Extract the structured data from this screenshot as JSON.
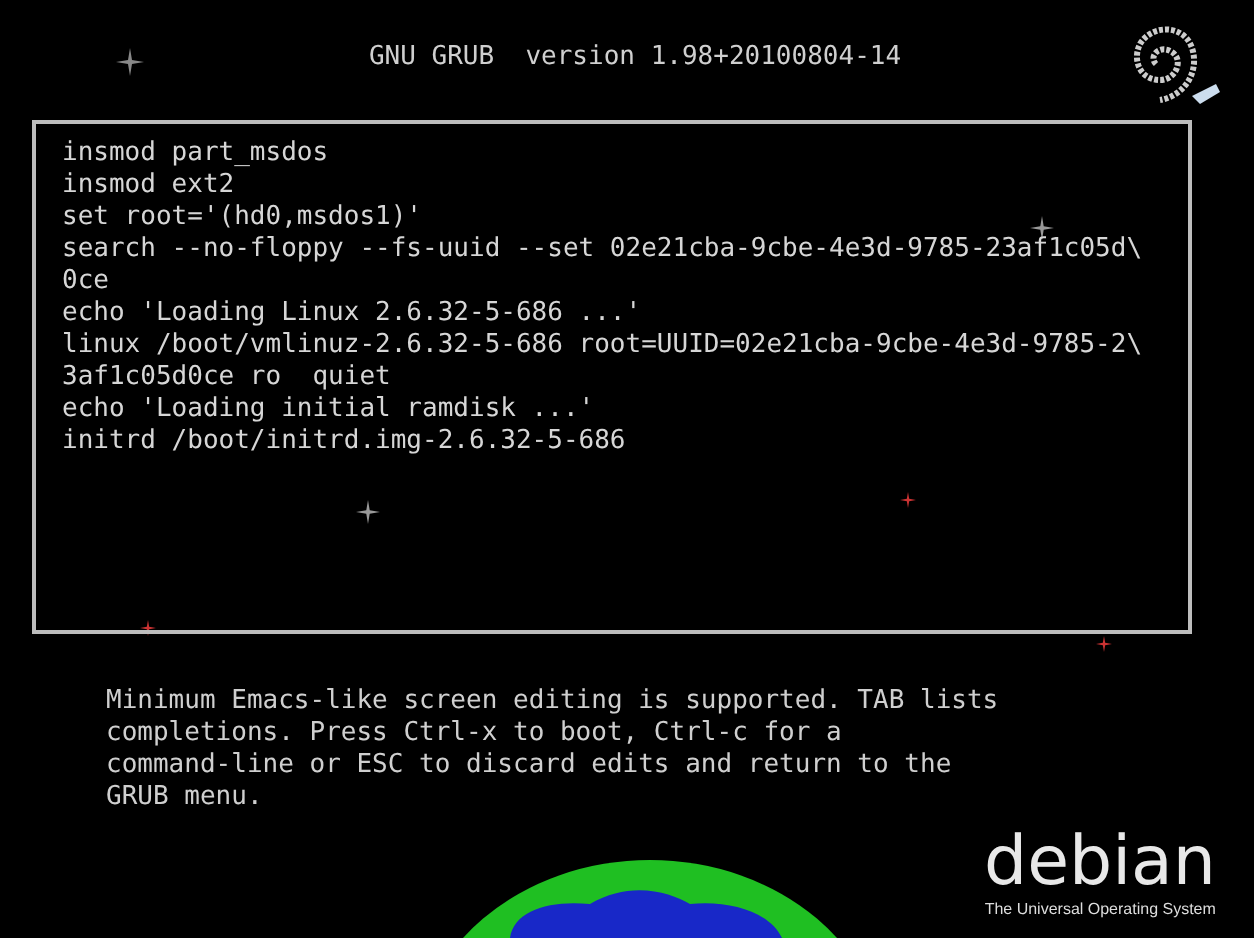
{
  "header": {
    "title": "GNU GRUB  version 1.98+20100804-14"
  },
  "editor": {
    "lines": [
      "insmod part_msdos",
      "insmod ext2",
      "set root='(hd0,msdos1)'",
      "search --no-floppy --fs-uuid --set 02e21cba-9cbe-4e3d-9785-23af1c05d\\",
      "0ce",
      "echo 'Loading Linux 2.6.32-5-686 ...'",
      "linux /boot/vmlinuz-2.6.32-5-686 root=UUID=02e21cba-9cbe-4e3d-9785-2\\",
      "3af1c05d0ce ro  quiet",
      "echo 'Loading initial ramdisk ...'",
      "initrd /boot/initrd.img-2.6.32-5-686"
    ]
  },
  "help_text": [
    "Minimum Emacs-like screen editing is supported. TAB lists",
    "completions. Press Ctrl-x to boot, Ctrl-c for a",
    "command-line or ESC to discard edits and return to the",
    "GRUB menu."
  ],
  "branding": {
    "wordmark": "debian",
    "tagline": "The Universal Operating System"
  }
}
